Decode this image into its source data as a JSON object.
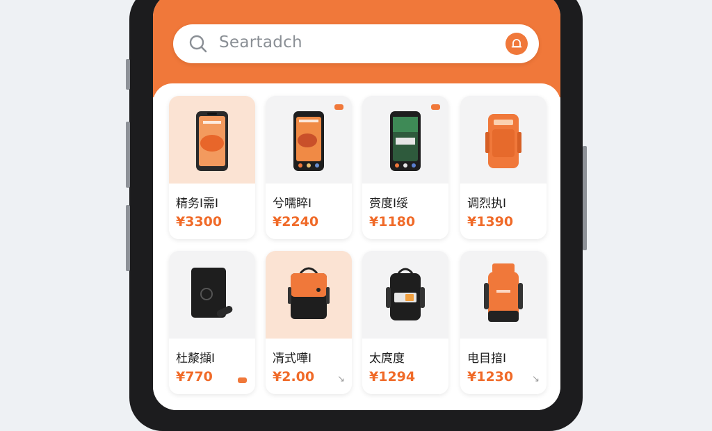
{
  "search": {
    "placeholder": "Seartadch"
  },
  "colors": {
    "accent": "#f0783a",
    "price": "#f06a28"
  },
  "products": [
    {
      "name": "精务I需I",
      "price": "¥3300",
      "image": "phone-orange"
    },
    {
      "name": "兮嚅睟I",
      "price": "¥2240",
      "image": "phone-orange-dark"
    },
    {
      "name": "赍度I绥",
      "price": "¥1180",
      "image": "phone-green"
    },
    {
      "name": "调烈执I",
      "price": "¥1390",
      "image": "orange-pouch"
    },
    {
      "name": "杜漦擷I",
      "price": "¥770",
      "image": "black-tablet"
    },
    {
      "name": "凊式嘩I",
      "price": "¥2.00",
      "image": "orange-messenger-bag"
    },
    {
      "name": "太庹度",
      "price": "¥1294",
      "image": "black-backpack"
    },
    {
      "name": "电目揞I",
      "price": "¥1230",
      "image": "orange-rolltop-backpack"
    }
  ]
}
